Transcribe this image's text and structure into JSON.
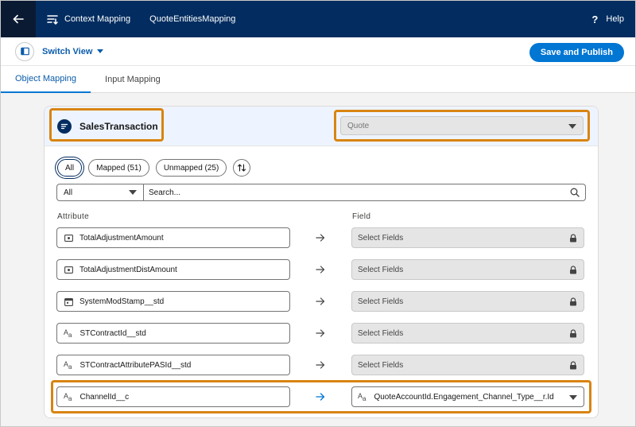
{
  "header": {
    "context_label": "Context Mapping",
    "mapping_name": "QuoteEntitiesMapping",
    "help_label": "Help"
  },
  "toolbar": {
    "switch_view_label": "Switch View",
    "save_label": "Save and Publish"
  },
  "tabs": [
    {
      "label": "Object Mapping",
      "active": true
    },
    {
      "label": "Input Mapping",
      "active": false
    }
  ],
  "card": {
    "object_name": "SalesTransaction",
    "object_select_value": "Quote",
    "filters": [
      {
        "label": "All",
        "selected": true
      },
      {
        "label": "Mapped (51)",
        "selected": false
      },
      {
        "label": "Unmapped (25)",
        "selected": false
      }
    ],
    "type_filter_value": "All",
    "search_placeholder": "Search...",
    "attribute_header": "Attribute",
    "field_header": "Field",
    "rows": [
      {
        "attribute": "TotalAdjustmentAmount",
        "icon": "currency-icon",
        "field": "Select Fields",
        "mapped": false
      },
      {
        "attribute": "TotalAdjustmentDistAmount",
        "icon": "currency-icon",
        "field": "Select Fields",
        "mapped": false
      },
      {
        "attribute": "SystemModStamp__std",
        "icon": "calendar-icon",
        "field": "Select Fields",
        "mapped": false
      },
      {
        "attribute": "STContractId__std",
        "icon": "text-icon",
        "field": "Select Fields",
        "mapped": false
      },
      {
        "attribute": "STContractAttributePASId__std",
        "icon": "text-icon",
        "field": "Select Fields",
        "mapped": false
      },
      {
        "attribute": "ChannelId__c",
        "icon": "text-icon",
        "field": "QuoteAccountId.Engagement_Channel_Type__r.Id",
        "mapped": true
      }
    ]
  },
  "colors": {
    "header_bg": "#032d60",
    "brand_blue": "#0176d3",
    "highlight": "#d98412"
  }
}
